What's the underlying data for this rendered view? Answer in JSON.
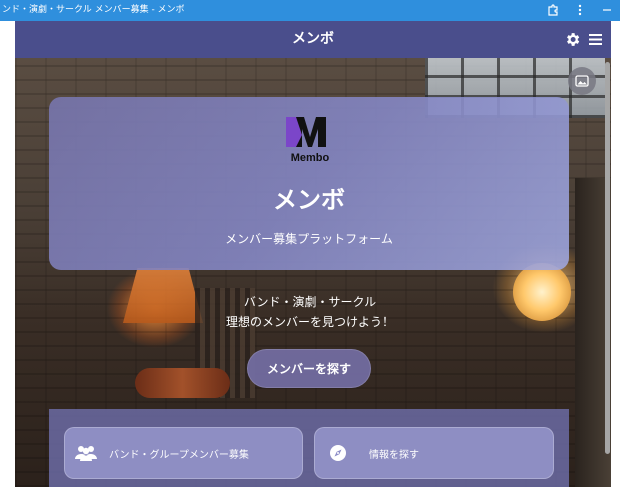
{
  "browser": {
    "title": "ンド・演劇・サークル メンバー募集 - メンボ"
  },
  "app": {
    "title": "メンボ",
    "icons": [
      "gear-icon",
      "hamburger-menu-icon",
      "image-icon"
    ]
  },
  "hero": {
    "logo_text": "Membo",
    "card_title": "メンボ",
    "card_subtitle": "メンバー募集プラットフォーム",
    "tagline_line1": "バンド・演劇・サークル",
    "tagline_line2": "理想のメンバーを見つけよう！",
    "cta_label": "メンバーを探す"
  },
  "tiles": [
    {
      "label": "バンド・グループメンバー募集",
      "icon": "people-icon"
    },
    {
      "label": "情報を探す",
      "icon": "compass-icon"
    }
  ],
  "colors": {
    "appbar": "#4a4e8c",
    "titlebar": "#2f8fdd",
    "logo_purple": "#6e3fb5"
  }
}
